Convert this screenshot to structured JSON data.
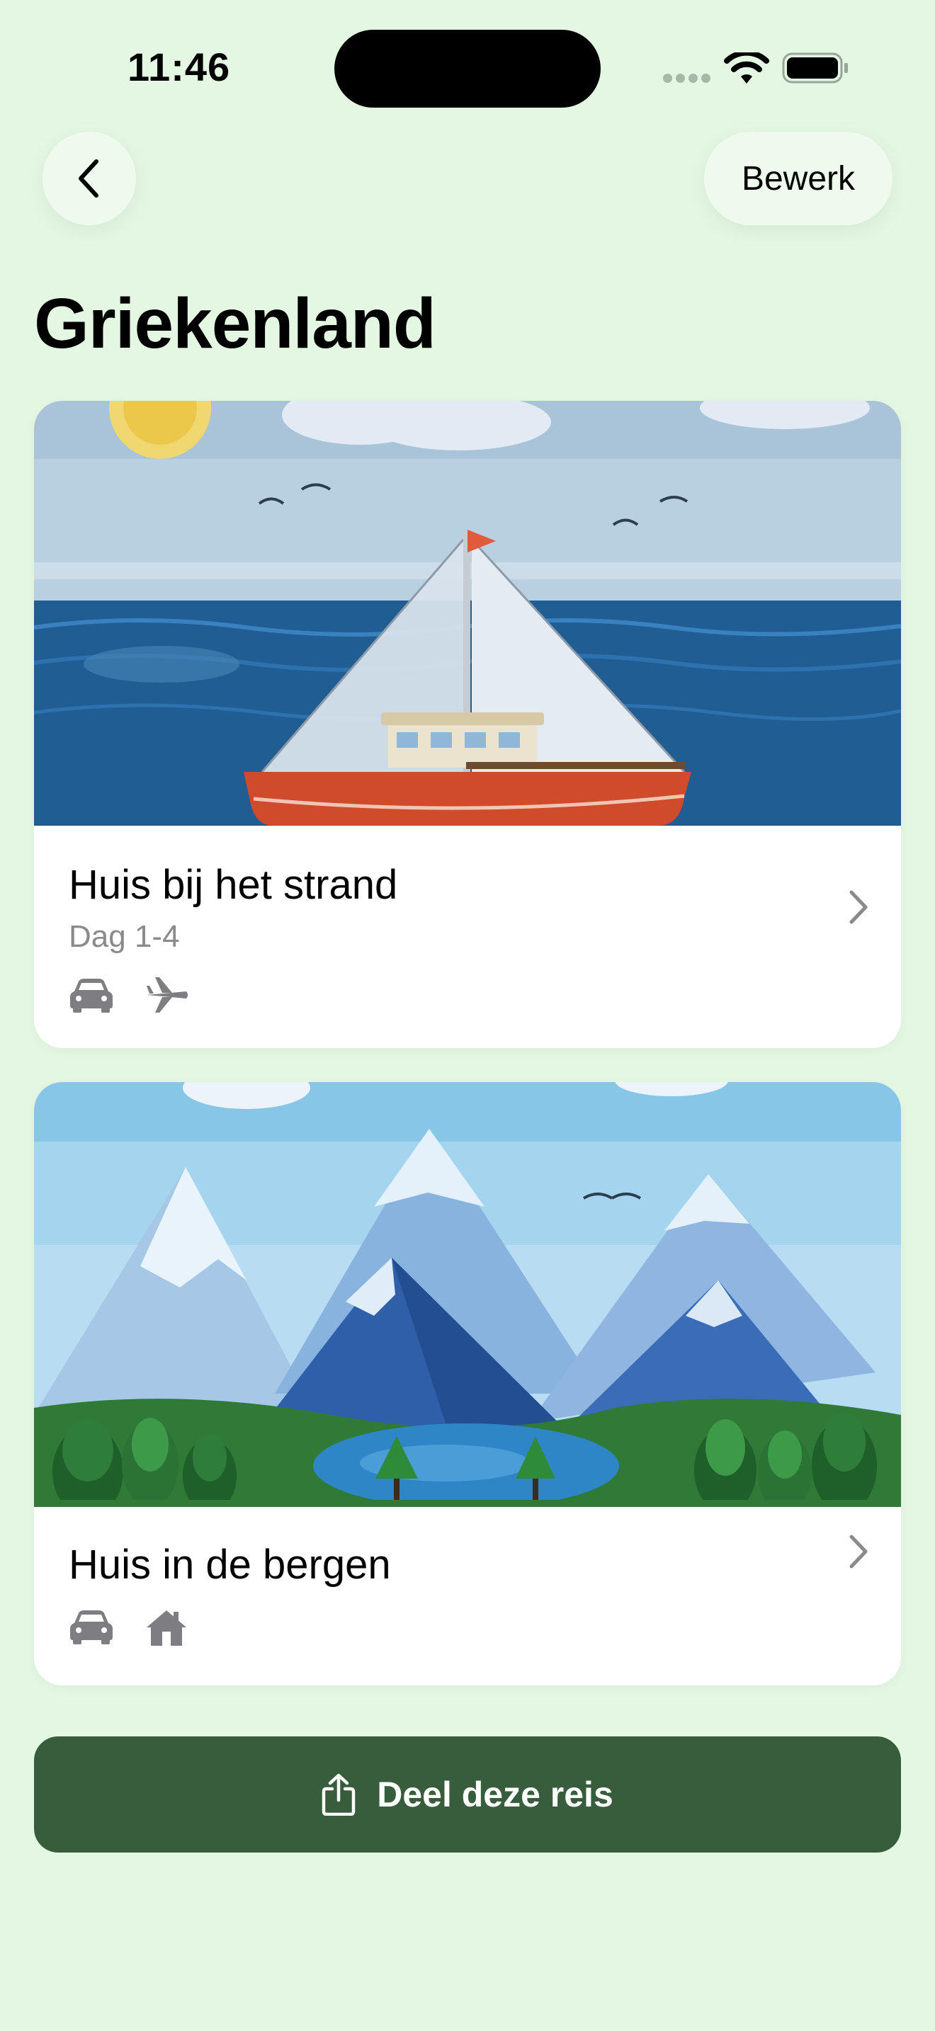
{
  "status_bar": {
    "time": "11:46"
  },
  "header": {
    "edit_label": "Bewerk"
  },
  "page": {
    "title": "Griekenland"
  },
  "trips": [
    {
      "title": "Huis bij het strand",
      "subtitle": "Dag 1-4",
      "icons": [
        "car-icon",
        "airplane-icon"
      ],
      "image": "sailboat-illustration"
    },
    {
      "title": "Huis in de bergen",
      "icons": [
        "car-icon",
        "house-icon"
      ],
      "image": "mountains-illustration"
    }
  ],
  "share": {
    "label": "Deel deze reis",
    "icon": "share-icon"
  },
  "colors": {
    "background": "#e3f7e3",
    "share_button": "#375d3c",
    "secondary_text": "#8a8a8e"
  }
}
